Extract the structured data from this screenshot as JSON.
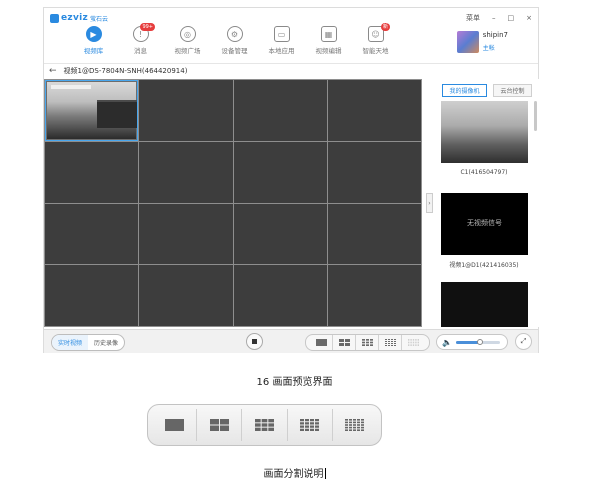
{
  "app": {
    "logo_text": "ezviz",
    "logo_sub": "萤石云",
    "menu_label": "菜单",
    "minimize_glyph": "–",
    "maximize_glyph": "□",
    "close_glyph": "×",
    "nav": [
      {
        "label": "视频库",
        "icon": "play-icon",
        "active": true
      },
      {
        "label": "消息",
        "icon": "message-icon",
        "badge": "99+"
      },
      {
        "label": "视频广场",
        "icon": "reel-icon"
      },
      {
        "label": "设备管理",
        "icon": "gear-icon"
      },
      {
        "label": "本地应用",
        "icon": "monitor-icon"
      },
      {
        "label": "视频编辑",
        "icon": "film-icon"
      },
      {
        "label": "智能天地",
        "icon": "robot-icon",
        "badge": "新"
      }
    ],
    "user": {
      "name": "shipin7",
      "role": "主帐"
    },
    "device_title": "视频1@DS-7804N-SNH(464420914)"
  },
  "side_panel": {
    "tabs": [
      {
        "label": "我的摄像机",
        "active": true
      },
      {
        "label": "云台控制",
        "active": false
      }
    ],
    "cameras": [
      {
        "caption": "C1(416504797)",
        "signal_text": ""
      },
      {
        "caption": "视频1@D1(421416035)",
        "signal_text": "无视频信号"
      },
      {
        "caption": "",
        "signal_text": ""
      }
    ]
  },
  "bottom": {
    "live_label": "实时视频",
    "history_label": "历史录像",
    "volume_level": 0.55,
    "split_modes": [
      1,
      4,
      9,
      16,
      25
    ]
  },
  "captions": {
    "preview": "16 画面预览界面",
    "split": "画面分割说明"
  }
}
